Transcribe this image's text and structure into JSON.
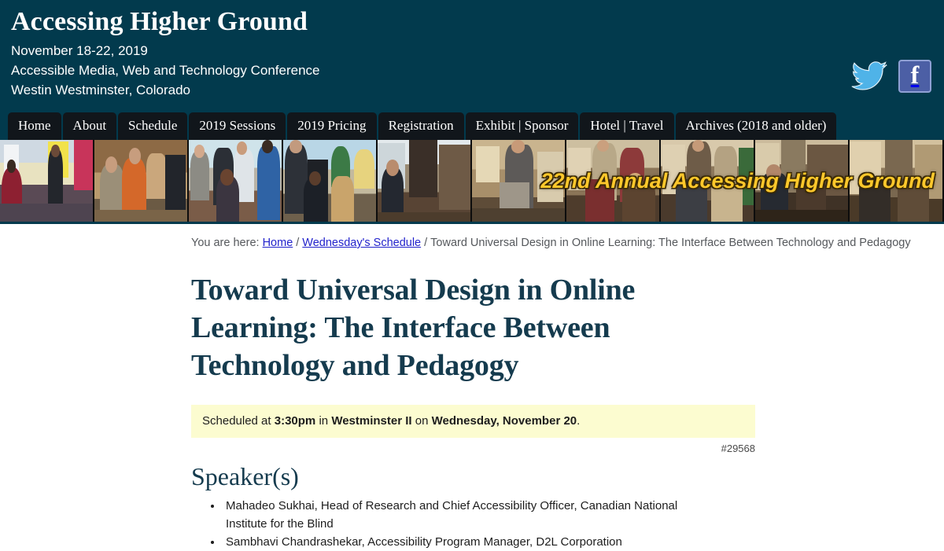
{
  "header": {
    "site_title": "Accessing Higher Ground",
    "dates": "November 18-22, 2019",
    "subtitle": "Accessible Media, Web and Technology Conference",
    "venue": "Westin Westminster, Colorado",
    "social": {
      "twitter_label": "Twitter",
      "facebook_label": "f"
    },
    "colors": {
      "header_bg": "#023a4d",
      "nav_bg": "#11161b",
      "banner_caption": "#ffc82b",
      "twitter_blue": "#4fb3e8",
      "facebook_blue": "#4c5fa5"
    }
  },
  "nav": {
    "items": [
      {
        "label": "Home"
      },
      {
        "label": "About"
      },
      {
        "label": "Schedule"
      },
      {
        "label": "2019 Sessions"
      },
      {
        "label": "2019 Pricing"
      },
      {
        "label": "Registration"
      },
      {
        "label": "Exhibit | Sponsor"
      },
      {
        "label": "Hotel | Travel"
      },
      {
        "label": "Archives (2018 and older)"
      }
    ]
  },
  "banner": {
    "caption": "22nd Annual Accessing Higher Ground"
  },
  "breadcrumb": {
    "prefix": "You are here:",
    "home": "Home",
    "schedule": "Wednesday's Schedule",
    "current": "Toward Universal Design in Online Learning: The Interface Between Technology and Pedagogy",
    "separator": "/"
  },
  "main": {
    "title": "Toward Universal Design in Online Learning: The Interface Between Technology and Pedagogy",
    "schedule": {
      "lead": "Scheduled at",
      "time": "3:30pm",
      "in_word": "in",
      "room": "Westminster II",
      "on_word": "on",
      "day": "Wednesday, November 20",
      "period": "."
    },
    "session_id": "#29568",
    "speakers_heading": "Speaker(s)",
    "speakers": [
      "Mahadeo Sukhai, Head of Research and Chief Accessibility Officer, Canadian National Institute for the Blind",
      "Sambhavi Chandrashekar, Accessibility Program Manager, D2L Corporation"
    ]
  }
}
